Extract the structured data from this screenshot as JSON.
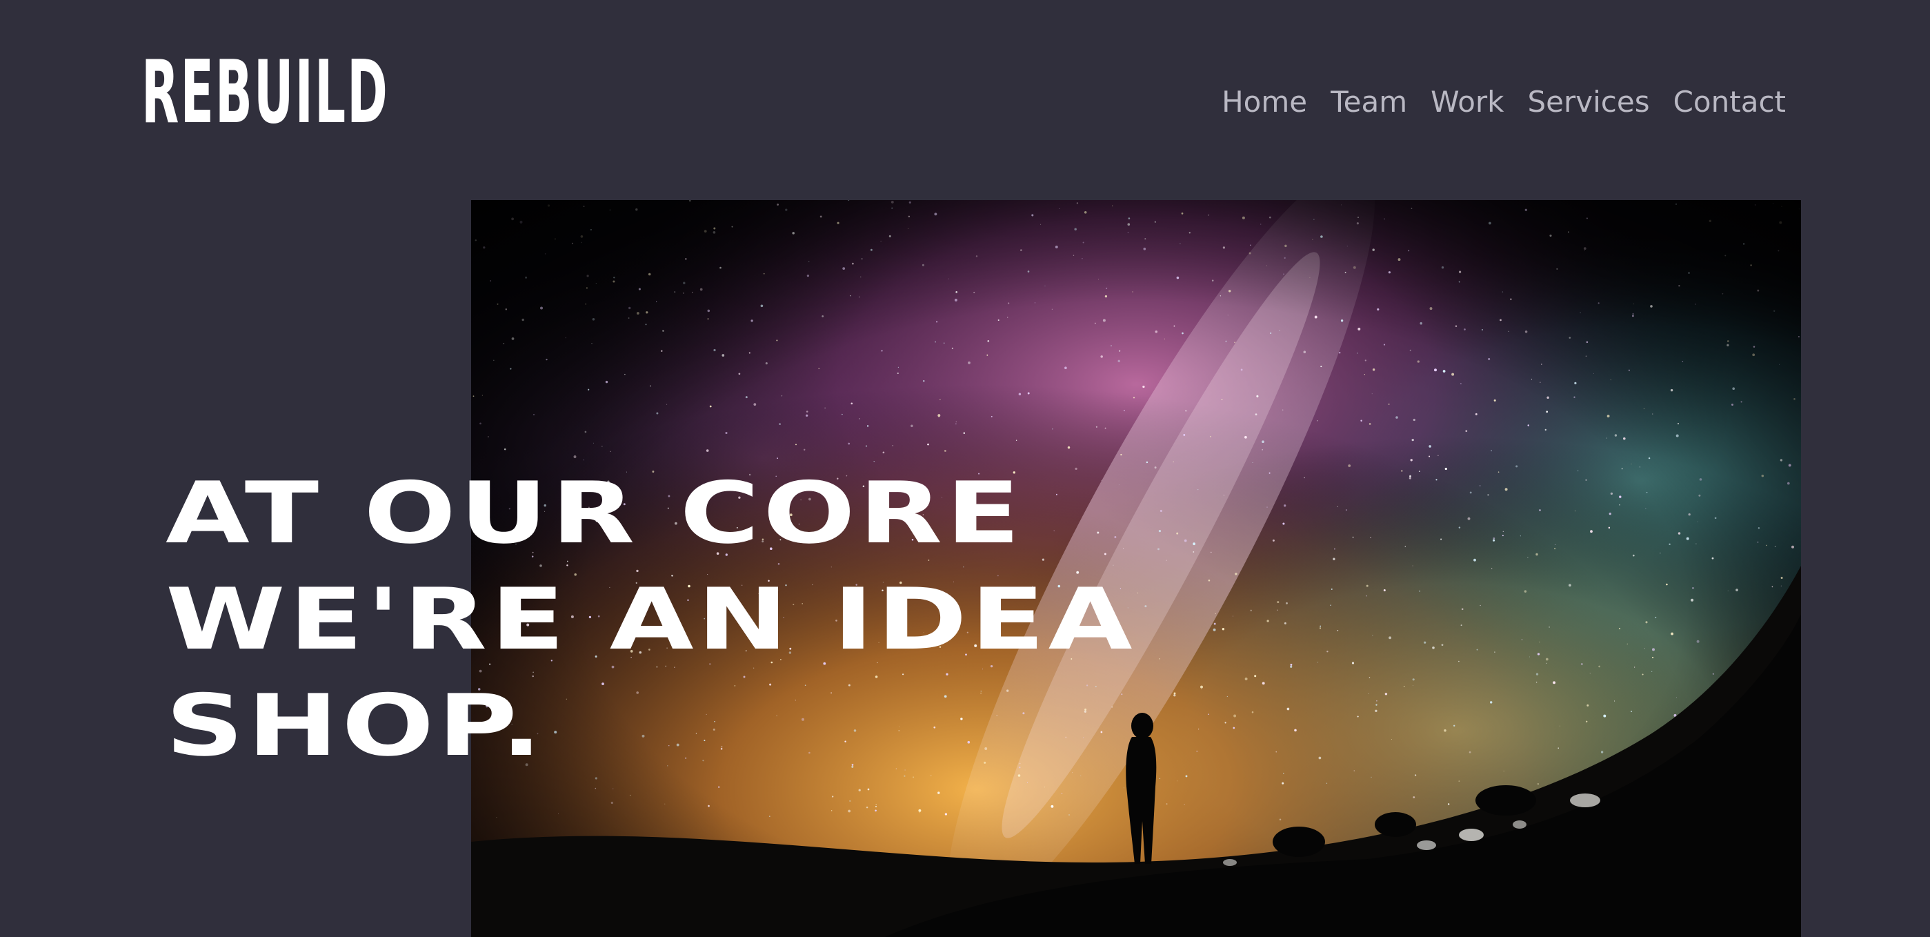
{
  "header": {
    "logo_text": "REBUILD",
    "nav": [
      {
        "label": "Home"
      },
      {
        "label": "Team"
      },
      {
        "label": "Work"
      },
      {
        "label": "Services"
      },
      {
        "label": "Contact"
      }
    ]
  },
  "hero": {
    "headline_lines": [
      "AT OUR CORE",
      "WE'RE AN IDEA",
      "SHOP."
    ],
    "image": "night-sky-milky-way-silhouette"
  },
  "colors": {
    "background": "#302f3c",
    "nav_text": "#b9b8c3",
    "headline_text": "#ffffff"
  }
}
